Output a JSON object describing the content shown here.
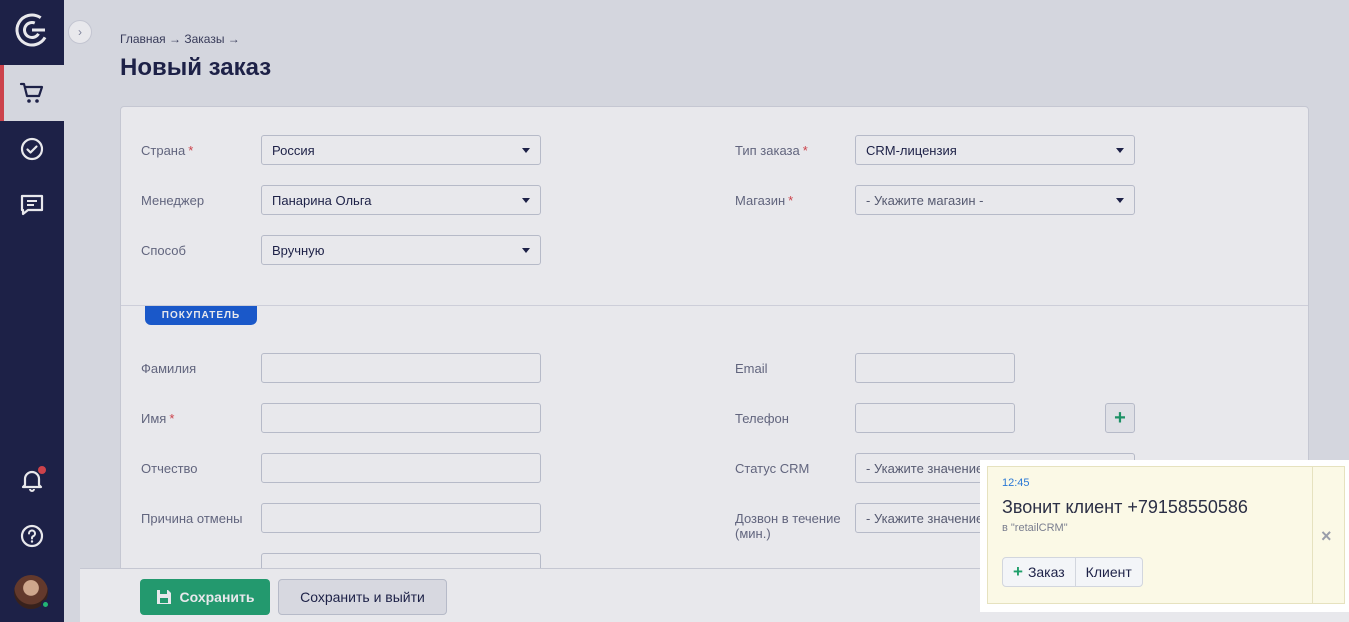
{
  "colors": {
    "sidebar": "#1e2248",
    "accent_red": "#e0474c",
    "primary_green": "#24a873",
    "tag_blue": "#1a5fd9"
  },
  "sidebar": {
    "items": [
      {
        "icon": "logo-icon"
      },
      {
        "icon": "cart-icon",
        "active": true
      },
      {
        "icon": "check-circle-icon"
      },
      {
        "icon": "chat-icon"
      },
      {
        "icon": "bell-icon"
      },
      {
        "icon": "help-icon"
      }
    ]
  },
  "header": {
    "breadcrumb": "Главная → Заказы →",
    "title": "Новый заказ"
  },
  "form": {
    "country": {
      "label": "Страна",
      "value": "Россия"
    },
    "manager": {
      "label": "Менеджер",
      "value": "Панарина Ольга"
    },
    "method": {
      "label": "Способ",
      "value": "Вручную"
    },
    "order_type": {
      "label": "Тип заказа",
      "value": "CRM-лицензия"
    },
    "shop": {
      "label": "Магазин",
      "placeholder": "- Укажите магазин -"
    },
    "required_mark": "*"
  },
  "buyer": {
    "section_tag": "ПОКУПАТЕЛЬ",
    "last_name": {
      "label": "Фамилия",
      "value": ""
    },
    "first_name": {
      "label": "Имя",
      "value": ""
    },
    "middle_name": {
      "label": "Отчество",
      "value": ""
    },
    "cancel_reason": {
      "label": "Причина отмены",
      "value": ""
    },
    "email": {
      "label": "Email",
      "value": ""
    },
    "phone": {
      "label": "Телефон",
      "value": ""
    },
    "crm_status": {
      "label": "Статус CRM",
      "placeholder": "- Укажите значение -"
    },
    "dial_within": {
      "label_line1": "Дозвон в течение",
      "label_line2": "(мин.)",
      "placeholder": "- Укажите значение -"
    },
    "add_phone": "+"
  },
  "actions": {
    "save": "Сохранить",
    "save_exit": "Сохранить и выйти"
  },
  "notification": {
    "time": "12:45",
    "title": "Звонит клиент +79158550586",
    "subtitle": "в \"retailCRM\"",
    "order_button": "Заказ",
    "client_button": "Клиент",
    "close": "×"
  }
}
